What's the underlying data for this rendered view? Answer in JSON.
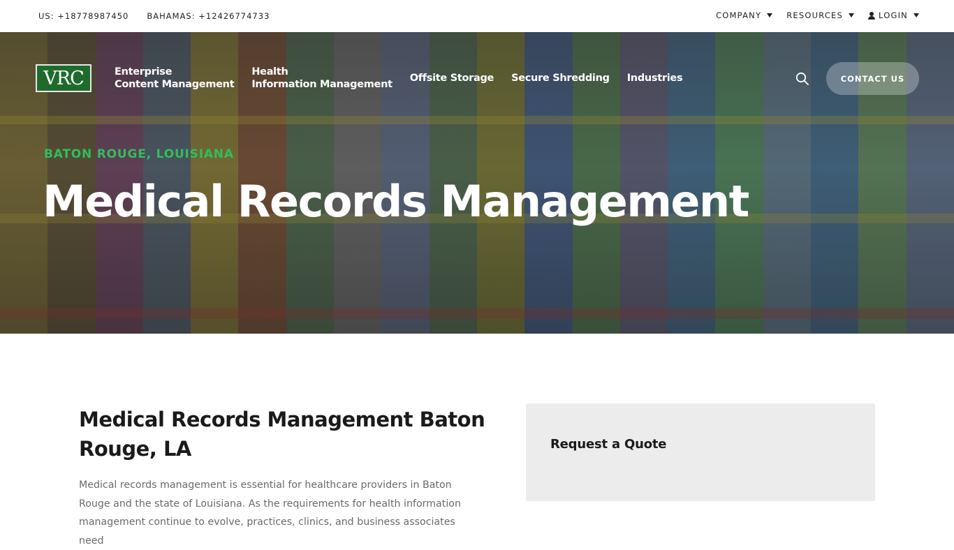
{
  "topbar": {
    "phone_us": "US: +18778987450",
    "phone_bahamas": "BAHAMAS: +12426774733",
    "menu": [
      "COMPANY",
      "RESOURCES",
      "LOGIN"
    ]
  },
  "logo": {
    "text": "VRC"
  },
  "nav": {
    "item1_line1": "Enterprise",
    "item1_line2": "Content Management",
    "item2_line1": "Health",
    "item2_line2": "Information Management",
    "item3": "Offsite Storage",
    "item4": "Secure Shredding",
    "item5": "Industries",
    "contact": "CONTACT US"
  },
  "hero": {
    "kicker": "BATON ROUGE, LOUISIANA",
    "title": "Medical Records Management"
  },
  "main": {
    "title": "Medical Records Management Baton Rouge, LA",
    "paragraph": "Medical records management is essential for healthcare providers in Baton Rouge and the state of Louisiana. As the requirements for health information management continue to evolve, practices, clinics, and business associates need"
  },
  "quote": {
    "title": "Request a Quote"
  },
  "colors": {
    "accent_green": "#2fbf5c",
    "logo_green": "#1f6b2c"
  }
}
